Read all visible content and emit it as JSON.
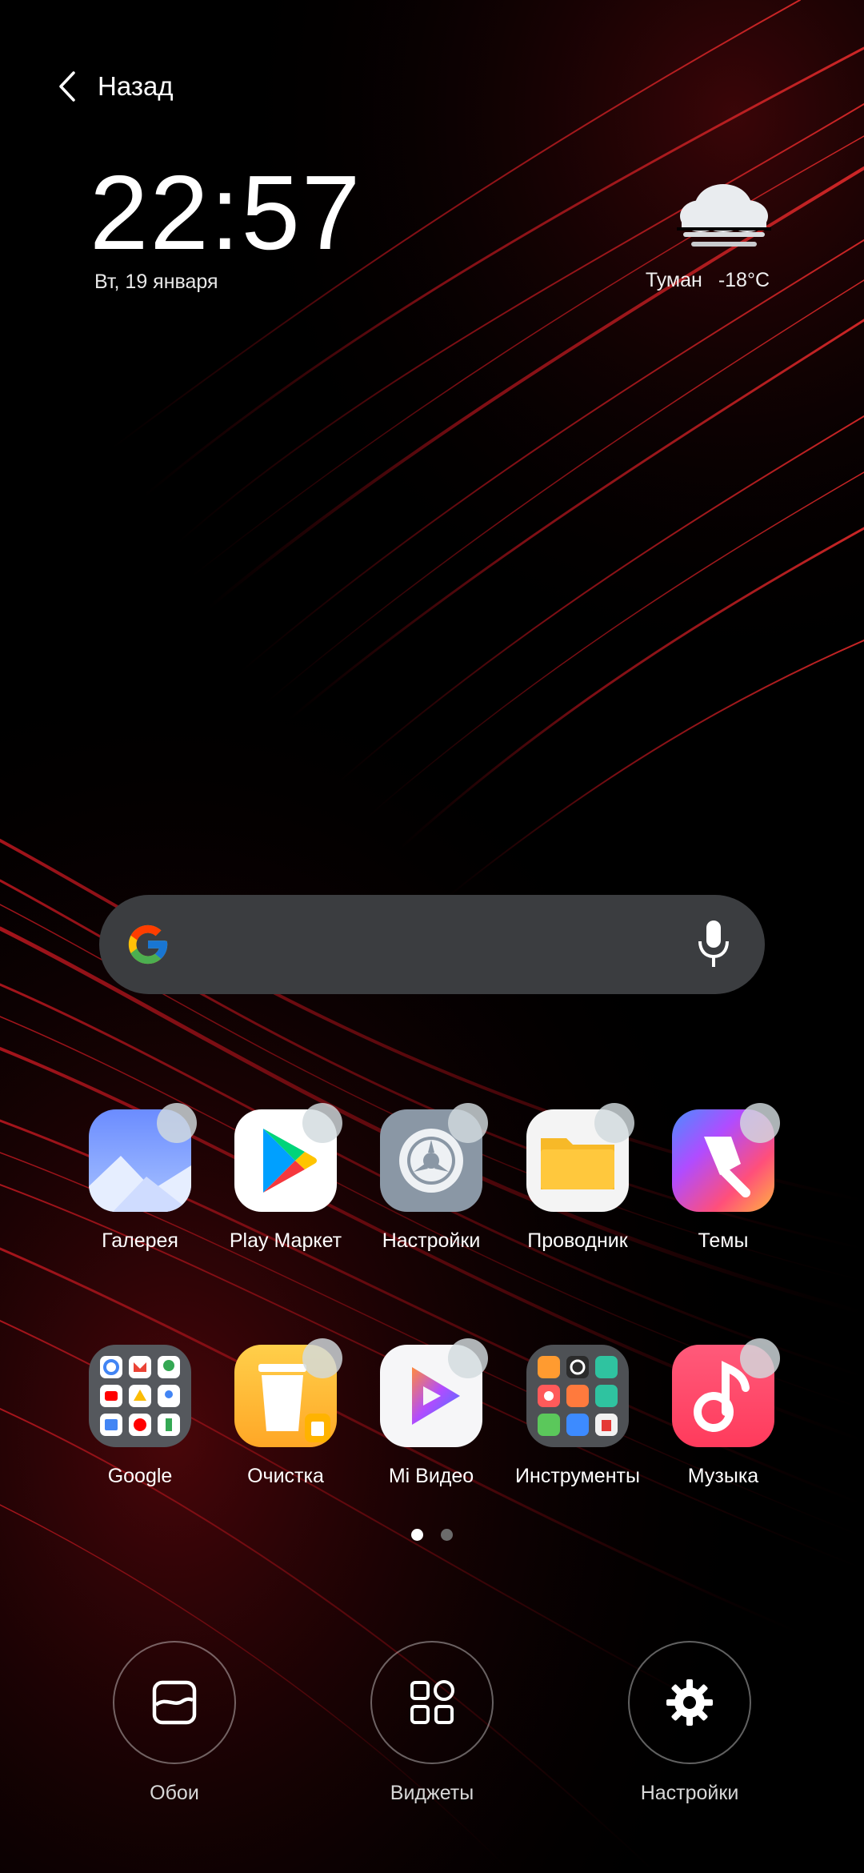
{
  "nav": {
    "back_label": "Назад"
  },
  "clock": {
    "time": "22:57",
    "date": "Вт, 19 января"
  },
  "weather": {
    "condition": "Туман",
    "temperature": "-18°C",
    "icon": "fog-icon"
  },
  "search": {
    "logo": "google-g-icon",
    "mic": "microphone-icon"
  },
  "apps": {
    "row1": [
      {
        "label": "Галерея",
        "icon": "gallery-icon"
      },
      {
        "label": "Play Маркет",
        "icon": "play-store-icon"
      },
      {
        "label": "Настройки",
        "icon": "settings-gear-icon"
      },
      {
        "label": "Проводник",
        "icon": "file-manager-folder-icon"
      },
      {
        "label": "Темы",
        "icon": "themes-brush-icon"
      }
    ],
    "row2": [
      {
        "label": "Google",
        "icon": "google-folder-icon"
      },
      {
        "label": "Очистка",
        "icon": "cleaner-trash-icon"
      },
      {
        "label": "Mi Видео",
        "icon": "mi-video-play-icon"
      },
      {
        "label": "Инструменты",
        "icon": "tools-folder-icon"
      },
      {
        "label": "Музыка",
        "icon": "music-note-icon"
      }
    ]
  },
  "pagination": {
    "total": 2,
    "active": 1
  },
  "actions": [
    {
      "label": "Обои",
      "icon": "wallpaper-icon"
    },
    {
      "label": "Виджеты",
      "icon": "widgets-grid-icon"
    },
    {
      "label": "Настройки",
      "icon": "settings-gear-icon"
    }
  ],
  "colors": {
    "background": "#000000",
    "search_bar": "#3b3d40",
    "wallpaper_accent": "#c0121a",
    "dot_active": "#ffffff",
    "dot_inactive": "#6b6b6b"
  }
}
